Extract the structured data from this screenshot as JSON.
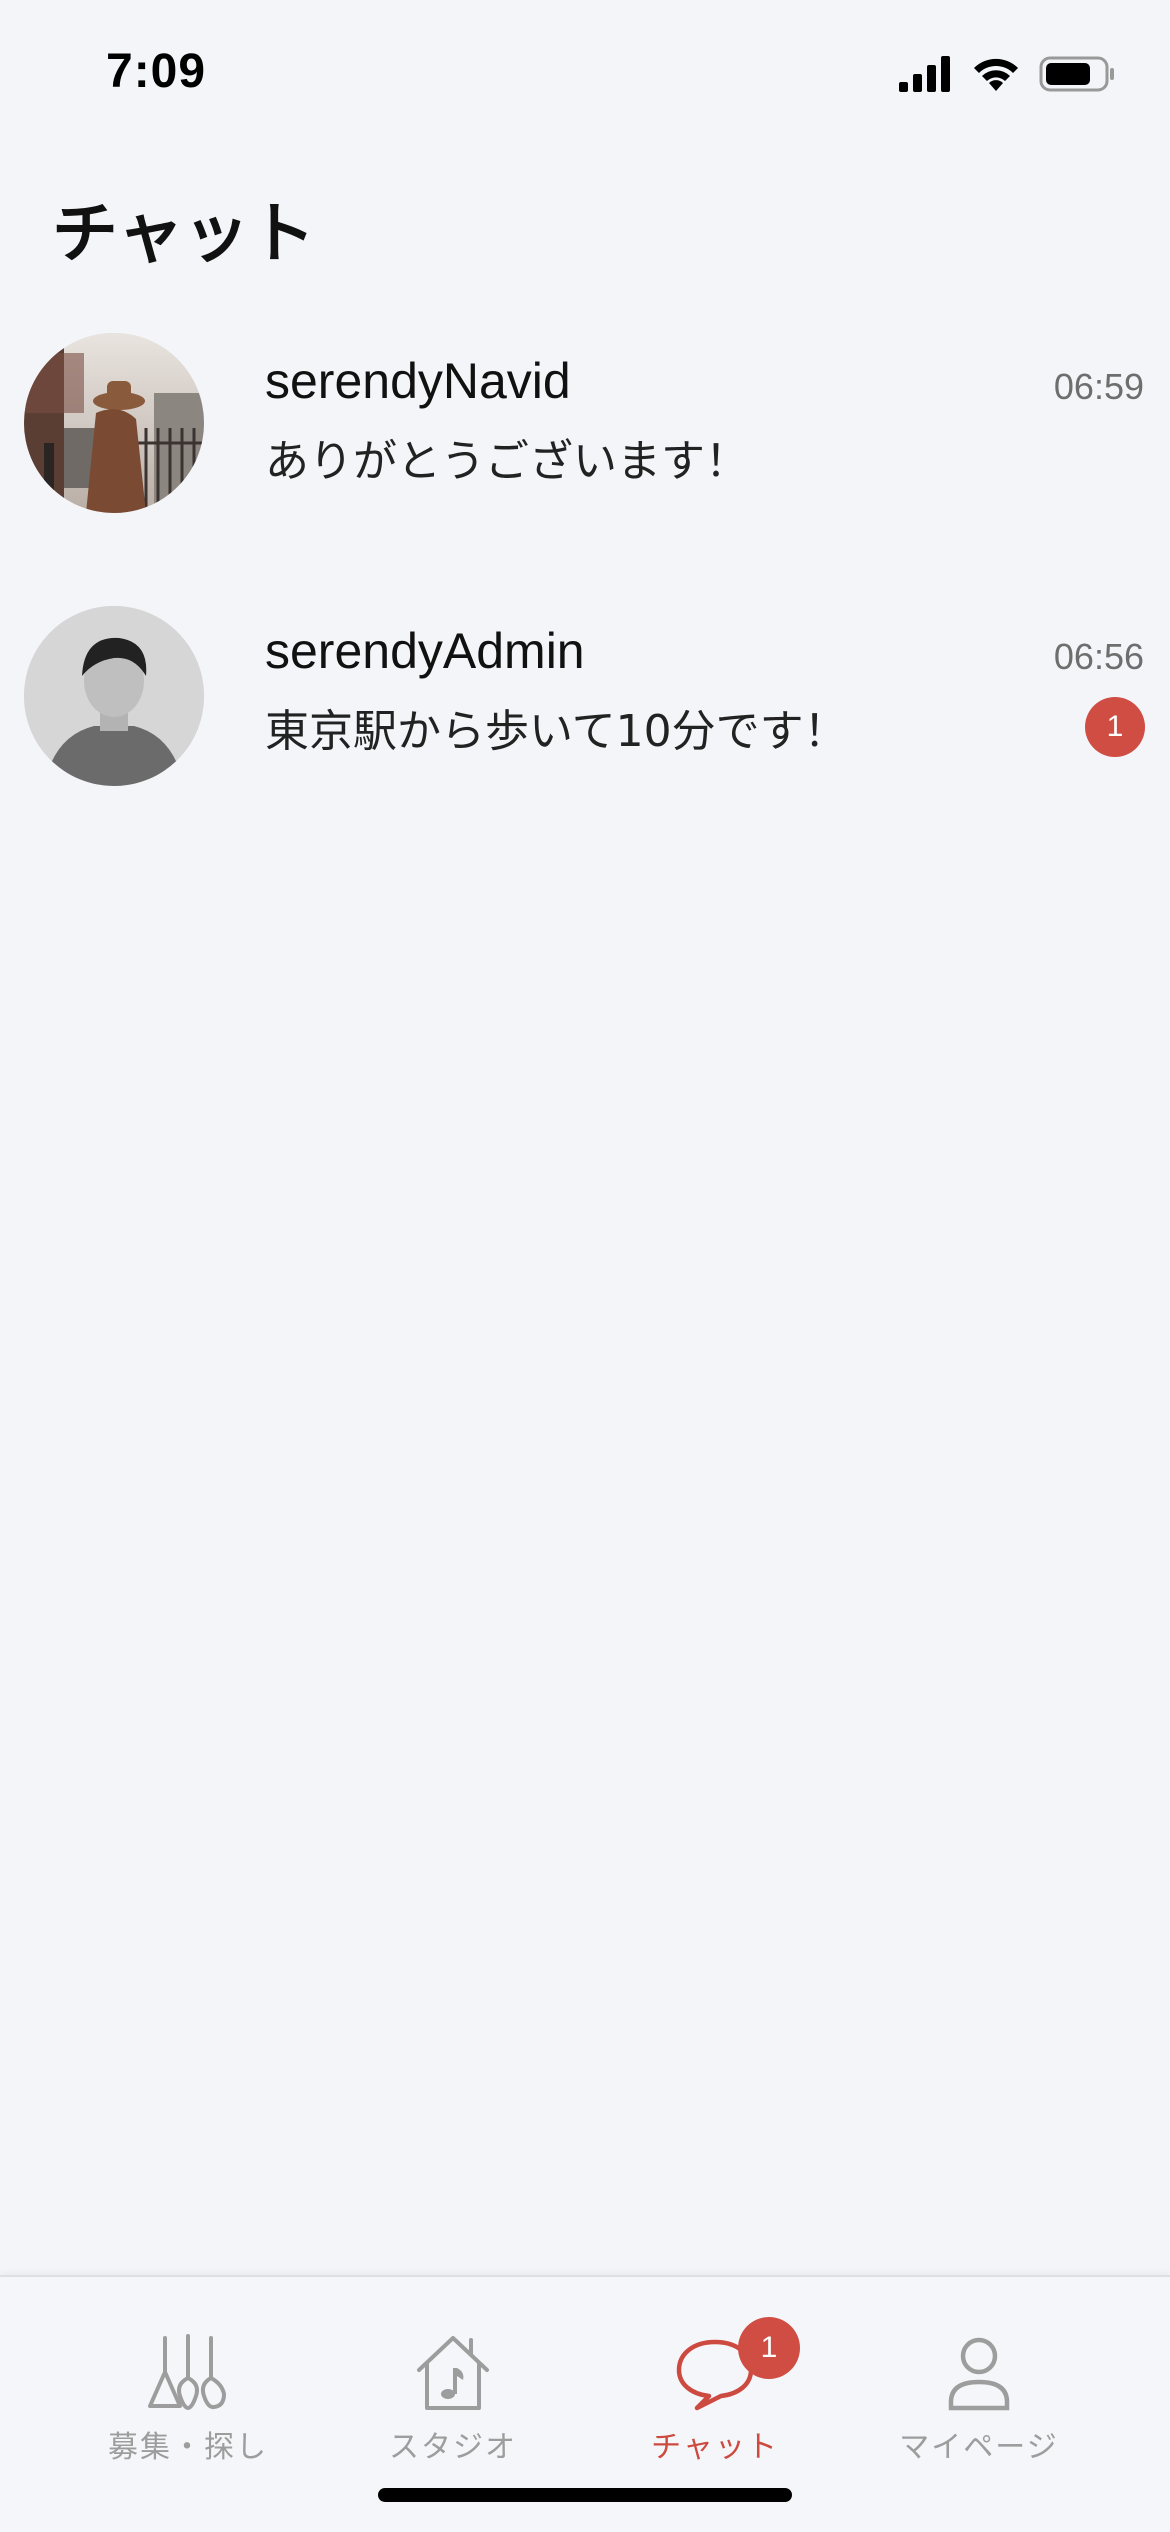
{
  "status_bar": {
    "time": "7:09"
  },
  "header": {
    "title": "チャット"
  },
  "chats": [
    {
      "name": "serendyNavid",
      "message": "ありがとうございます！",
      "time": "06:59",
      "unread": ""
    },
    {
      "name": "serendyAdmin",
      "message": "東京駅から歩いて10分です！",
      "time": "06:56",
      "unread": "1"
    }
  ],
  "tab_bar": {
    "tabs": [
      {
        "label": "募集・探し",
        "icon": "guitars-icon"
      },
      {
        "label": "スタジオ",
        "icon": "studio-house-icon"
      },
      {
        "label": "チャット",
        "icon": "chat-bubble-icon",
        "badge": "1"
      },
      {
        "label": "マイページ",
        "icon": "person-icon"
      }
    ],
    "active_tab": "チャット"
  },
  "colors": {
    "accent": "#d04d43",
    "background": "#f4f5f9",
    "inactive_tab": "#9d9d9d"
  }
}
